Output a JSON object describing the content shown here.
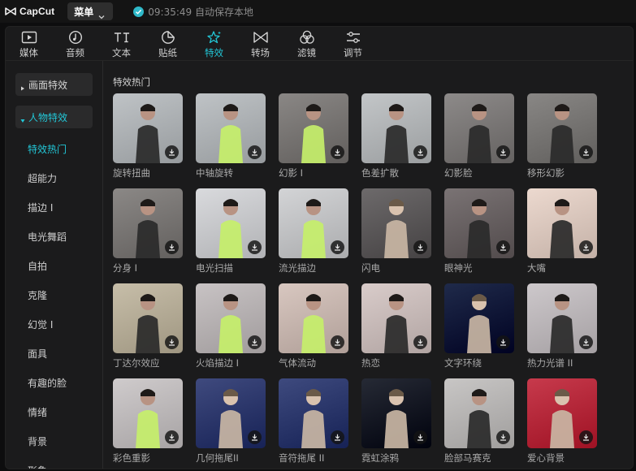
{
  "titlebar": {
    "app_name": "CapCut",
    "menu_label": "菜单",
    "save_status": "09:35:49 自动保存本地"
  },
  "tabs": [
    {
      "label": "媒体",
      "icon": "media-icon"
    },
    {
      "label": "音频",
      "icon": "audio-icon"
    },
    {
      "label": "文本",
      "icon": "text-icon"
    },
    {
      "label": "贴纸",
      "icon": "sticker-icon"
    },
    {
      "label": "特效",
      "icon": "effects-icon",
      "active": true
    },
    {
      "label": "转场",
      "icon": "transition-icon"
    },
    {
      "label": "滤镜",
      "icon": "filter-icon"
    },
    {
      "label": "调节",
      "icon": "adjust-icon"
    }
  ],
  "sidebar": {
    "categories": [
      {
        "label": "画面特效",
        "expanded": false
      },
      {
        "label": "人物特效",
        "expanded": true
      }
    ],
    "subitems": [
      "特效热门",
      "超能力",
      "描边 I",
      "电光舞蹈",
      "自拍",
      "克隆",
      "幻觉 I",
      "面具",
      "有趣的脸",
      "情绪",
      "背景",
      "形象"
    ],
    "active_subitem": "特效热门"
  },
  "content": {
    "section_title": "特效热门",
    "items": [
      {
        "name": "旋转扭曲",
        "bg": "#bfc3c6"
      },
      {
        "name": "中轴旋转",
        "bg": "#bfc3c6"
      },
      {
        "name": "幻影 I",
        "bg": "#8a8785"
      },
      {
        "name": "色差扩散",
        "bg": "#c3c6c8"
      },
      {
        "name": "幻影脸",
        "bg": "#8d8a89"
      },
      {
        "name": "移形幻影",
        "bg": "#898785"
      },
      {
        "name": "分身 I",
        "bg": "#8b8886"
      },
      {
        "name": "电光扫描",
        "bg": "#d9dadd"
      },
      {
        "name": "流光描边",
        "bg": "#d3d4d6"
      },
      {
        "name": "闪电",
        "bg": "#6d6a6b"
      },
      {
        "name": "眼神光",
        "bg": "#7a7374"
      },
      {
        "name": "大嘴",
        "bg": "#ecd9cf"
      },
      {
        "name": "丁达尔效应",
        "bg": "#c7bea9"
      },
      {
        "name": "火焰描边 I",
        "bg": "#c8c3c4"
      },
      {
        "name": "气体流动",
        "bg": "#d8c7c0"
      },
      {
        "name": "热恋",
        "bg": "#d9ccca"
      },
      {
        "name": "文字环绕",
        "bg": "#1f2a4a"
      },
      {
        "name": "热力光谱 II",
        "bg": "#cdc8cb"
      },
      {
        "name": "彩色重影",
        "bg": "#cfcbcc"
      },
      {
        "name": "几何拖尾II",
        "bg": "#3f4a7e"
      },
      {
        "name": "音符拖尾 II",
        "bg": "#3e4a7e"
      },
      {
        "name": "霓虹涂鸦",
        "bg": "#262a35"
      },
      {
        "name": "脸部马赛克",
        "bg": "#c8c6c5"
      },
      {
        "name": "爱心背景",
        "bg": "#c73a4c"
      }
    ]
  },
  "colors": {
    "accent": "#22c7d7",
    "panel": "#1b1b1c",
    "titlebar": "#141414"
  }
}
